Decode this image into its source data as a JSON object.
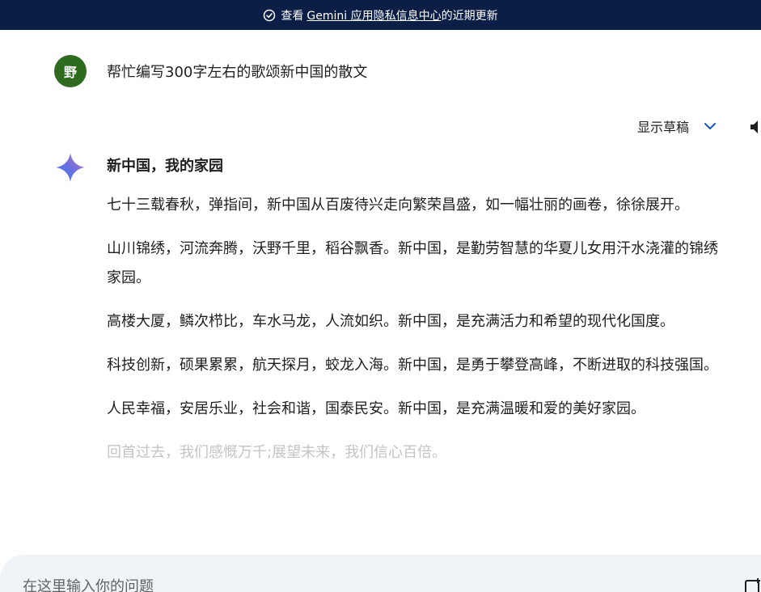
{
  "banner": {
    "prefix": "查看",
    "link_text": "Gemini 应用隐私信息中心",
    "suffix": "的近期更新"
  },
  "user": {
    "avatar_initial": "野",
    "prompt": "帮忙编写300字左右的歌颂新中国的散文"
  },
  "drafts": {
    "label": "显示草稿"
  },
  "response": {
    "title": "新中国，我的家园",
    "paragraphs": [
      "七十三载春秋，弹指间，新中国从百废待兴走向繁荣昌盛，如一幅壮丽的画卷，徐徐展开。",
      "山川锦绣，河流奔腾，沃野千里，稻谷飘香。新中国，是勤劳智慧的华夏儿女用汗水浇灌的锦绣家园。",
      "高楼大厦，鳞次栉比，车水马龙，人流如织。新中国，是充满活力和希望的现代化国度。",
      "科技创新，硕果累累，航天探月，蛟龙入海。新中国，是勇于攀登高峰，不断进取的科技强国。",
      "人民幸福，安居乐业，社会和谐，国泰民安。新中国，是充满温暖和爱的美好家园。",
      "回首过去，我们感慨万千;展望未来，我们信心百倍。"
    ]
  },
  "input": {
    "placeholder": "在这里输入你的问题"
  },
  "colors": {
    "banner_bg": "#0b1e45",
    "avatar_bg": "#2e6b1f",
    "accent_blue": "#1a56c4",
    "input_bg": "#f0f3f8"
  },
  "icons": [
    "shield-check-icon",
    "chevron-down-icon",
    "speaker-icon",
    "gemini-spark-icon",
    "image-upload-icon"
  ]
}
